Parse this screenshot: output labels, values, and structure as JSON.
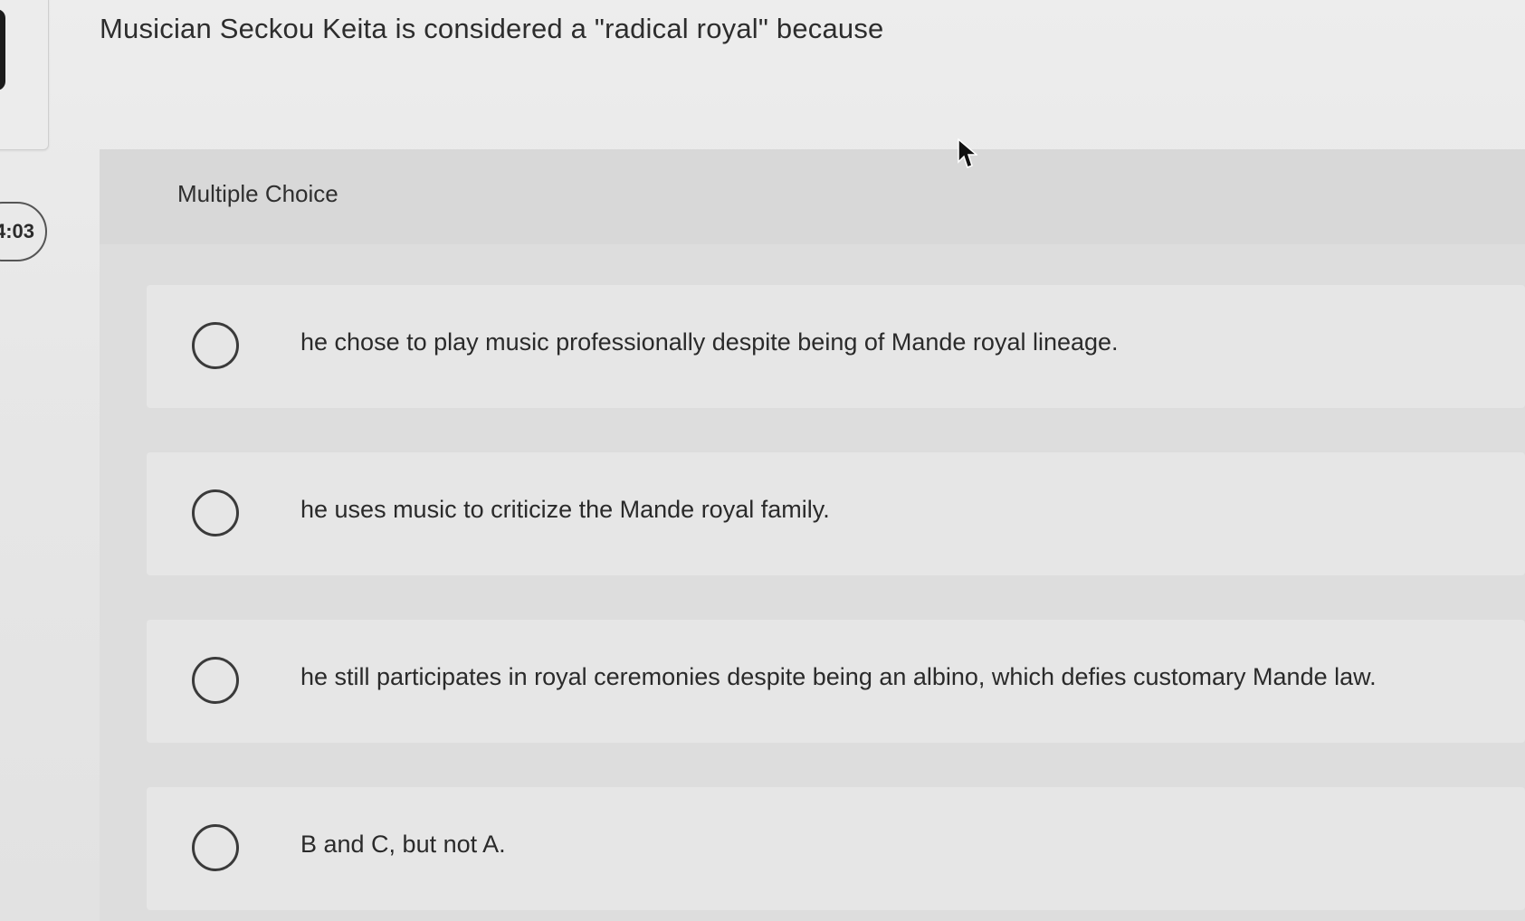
{
  "timer": {
    "text": "4:03"
  },
  "question": {
    "text": "Musician Seckou Keita is considered a \"radical royal\" because"
  },
  "multiple_choice": {
    "label": "Multiple Choice",
    "options": [
      {
        "text": "he chose to play music professionally despite being of Mande royal lineage.",
        "selected": false
      },
      {
        "text": "he uses music to criticize the Mande royal family.",
        "selected": false
      },
      {
        "text": "he still participates in royal ceremonies despite being an albino, which defies customary Mande law.",
        "selected": false
      },
      {
        "text": "B and C, but not A.",
        "selected": false
      }
    ]
  },
  "icons": {
    "radio": "radio-button-icon",
    "cursor": "mouse-pointer-icon"
  }
}
